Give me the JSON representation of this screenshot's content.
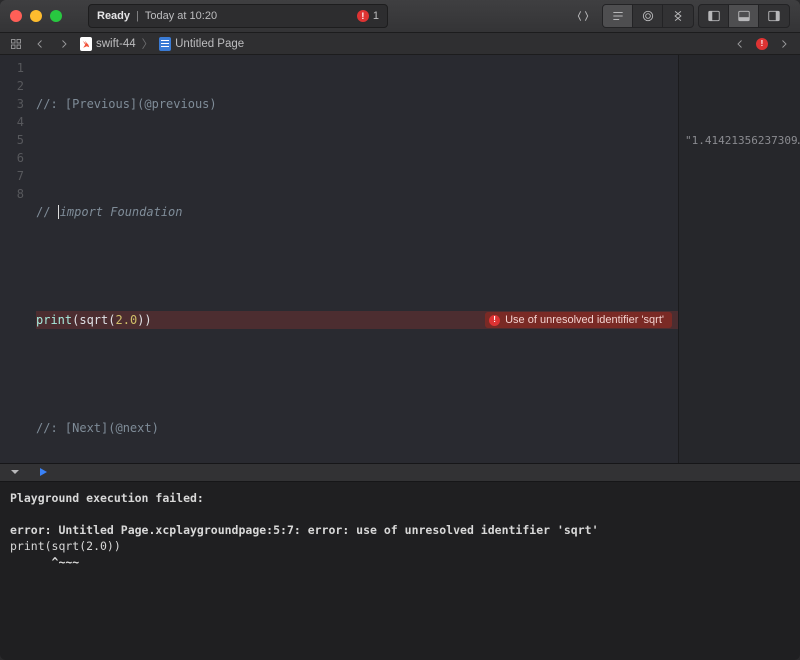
{
  "titlebar": {
    "status_ready": "Ready",
    "status_sep": " | ",
    "status_time": "Today at 10:20",
    "error_count": "1"
  },
  "breadcrumb": {
    "file": "swift-44",
    "page": "Untitled Page"
  },
  "editor": {
    "lines": {
      "l1": "//: [Previous](@previous)",
      "l3a": "// ",
      "l3b": "import Foundation",
      "l5_call": "print",
      "l5_open": "(",
      "l5_fn": "sqrt",
      "l5_open2": "(",
      "l5_num": "2.0",
      "l5_close": "))",
      "l7": "//: [Next](@next)"
    },
    "gutter": [
      "1",
      "2",
      "3",
      "4",
      "5",
      "6",
      "7",
      "8"
    ],
    "inline_error": "Use of unresolved identifier 'sqrt'"
  },
  "results": {
    "r5": "\"1.41421356237309…"
  },
  "console": {
    "line1": "Playground execution failed:",
    "line2": "",
    "line3": "error: Untitled Page.xcplaygroundpage:5:7: error: use of unresolved identifier 'sqrt'",
    "line4": "print(sqrt(2.0))",
    "line5": "      ^~~~"
  }
}
